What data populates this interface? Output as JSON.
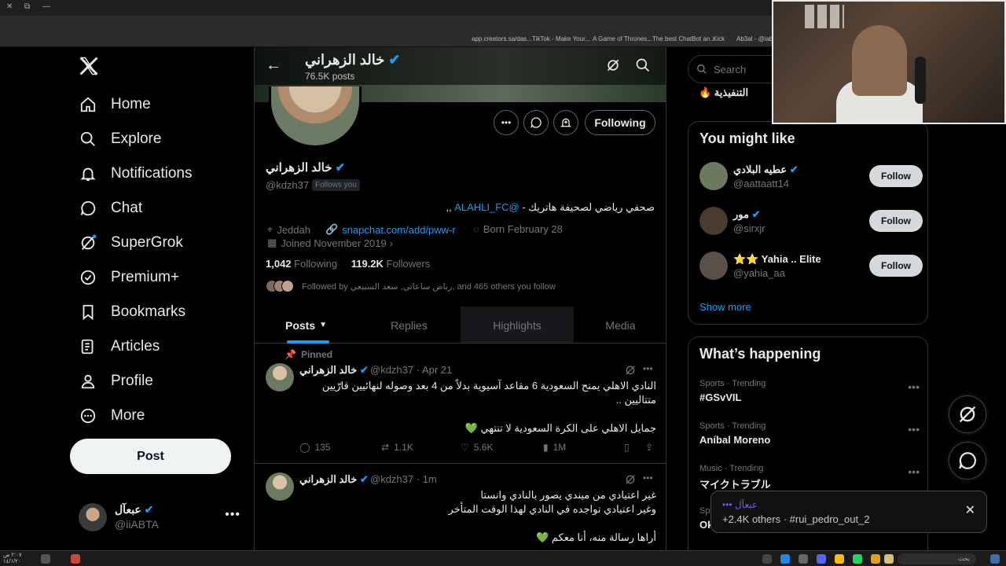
{
  "browser": {
    "bookmarks": [
      "app.creators.sa/das...",
      "TikTok - Make Your...",
      "A Game of Thrones...",
      "The best ChatBot an...",
      "Kick",
      "Ab3al - @iab3al"
    ]
  },
  "nav": {
    "items": [
      {
        "label": "Home",
        "icon": "home-icon"
      },
      {
        "label": "Explore",
        "icon": "search-icon"
      },
      {
        "label": "Notifications",
        "icon": "bell-icon"
      },
      {
        "label": "Chat",
        "icon": "chat-icon"
      },
      {
        "label": "SuperGrok",
        "icon": "grok-icon"
      },
      {
        "label": "Premium+",
        "icon": "verified-icon"
      },
      {
        "label": "Bookmarks",
        "icon": "bookmark-icon"
      },
      {
        "label": "Articles",
        "icon": "articles-icon"
      },
      {
        "label": "Profile",
        "icon": "profile-icon"
      },
      {
        "label": "More",
        "icon": "more-icon"
      }
    ],
    "post_label": "Post",
    "account": {
      "name": "عبعآل",
      "handle": "@iiABTA"
    }
  },
  "profile": {
    "header_name": "خالد الزهراني",
    "post_count": "76.5K posts",
    "name": "خالد الزهراني",
    "handle": "@kdzh37",
    "follows_you": "Follows you",
    "following_button": "Following",
    "bio_text": "صحفي رياضي لصحيفة هاتريك - ",
    "bio_link": "@ALAHLI_FC",
    "bio_tail": " ,,",
    "location": "Jeddah",
    "website": "snapchat.com/add/pww-r",
    "birthday": "Born February 28",
    "joined": "Joined November 2019",
    "following_count": "1,042",
    "following_label": "Following",
    "followers_count": "119.2K",
    "followers_label": "Followers",
    "followed_by": "Followed by رياض ساعاتي, سعد السبيعي, and 465 others you follow"
  },
  "tabs": [
    "Posts",
    "Replies",
    "Highlights",
    "Media"
  ],
  "tweets": [
    {
      "pinned": "Pinned",
      "name": "خالد الزهراني",
      "meta": "@kdzh37 · Apr 21",
      "lines": [
        "النادي الاهلي يمنح السعودية 6 مقاعد آسيوية بدلاً من 4 بعد وصوله لنهائيين قارّيين",
        "متتاليين ..",
        "",
        "جمايل الاهلي على الكرة السعودية لا تنتهي 💚"
      ],
      "replies": "135",
      "reposts": "1.1K",
      "likes": "5.6K",
      "views": "1M"
    },
    {
      "name": "خالد الزهراني",
      "meta": "@kdzh37 · 1m",
      "lines": [
        "غير اعتيادي من ميندي يصور بالنادي وانستا",
        "وغير اعتيادي تواجده في النادي لهذا الوقت المتأخر",
        "",
        "أراها رسالة منه، أنا معكم 💚"
      ]
    }
  ],
  "right": {
    "search_placeholder": "Search",
    "trend_top": "التنفيذية 🔥",
    "wtf_title": "You might like",
    "wtf": [
      {
        "name": "عطيه البلادي",
        "handle": "@aattaatt14",
        "button": "Follow",
        "color": "#6b7a5c"
      },
      {
        "name": "مور",
        "handle": "@sirxjr",
        "button": "Follow",
        "color": "#4a3a30"
      },
      {
        "name": "⭐⭐ Yahia .. Elite",
        "handle": "@yahia_aa",
        "button": "Follow",
        "color": "#5a5048"
      }
    ],
    "show_more": "Show more",
    "happening_title": "What’s happening",
    "trends": [
      {
        "category": "Sports · Trending",
        "title": "#GSvVIL"
      },
      {
        "category": "Sports · Trending",
        "title": "Aníbal Moreno"
      },
      {
        "category": "Music · Trending",
        "title": "マイクトラブル"
      }
    ],
    "partial_trend_cat": "Sp",
    "partial_trend_title": "Ok"
  },
  "toast": {
    "line1": "••• عبعآل",
    "line2": "+2.4K others · #rui_pedro_out_2"
  },
  "taskbar": {
    "search": "بحث",
    "time": "٢:٠٧ ص",
    "date": "١٤/١/٢٠"
  },
  "colors": {
    "accent": "#1d9bf0",
    "verified": "#1d9bf0",
    "bg": "#000000",
    "border": "#2f3336"
  }
}
